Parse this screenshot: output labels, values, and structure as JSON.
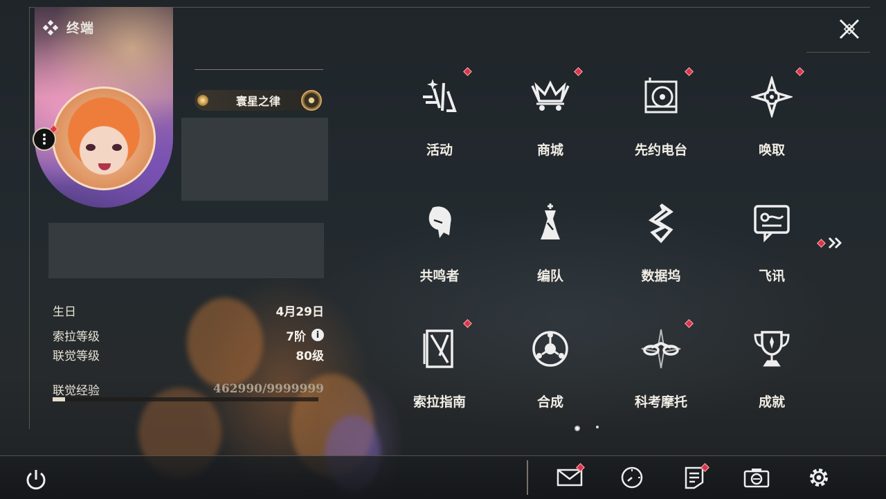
{
  "header": {
    "title": "终端"
  },
  "profile": {
    "nameplate": "寰星之律",
    "stats": [
      {
        "label": "生日",
        "value": "4月29日"
      },
      {
        "label": "索拉等级",
        "value": "7阶"
      },
      {
        "label": "联觉等级",
        "value": "80级"
      }
    ],
    "experience": {
      "label": "联觉经验",
      "value": "462990/9999999",
      "progress_fraction": 0.046
    }
  },
  "grid": {
    "items": [
      {
        "label": "活动",
        "icon": "activity-icon",
        "badge": true
      },
      {
        "label": "商城",
        "icon": "shop-crown-icon",
        "badge": true
      },
      {
        "label": "先约电台",
        "icon": "radio-icon",
        "badge": true
      },
      {
        "label": "唤取",
        "icon": "convene-compass-icon",
        "badge": true
      },
      {
        "label": "共鸣者",
        "icon": "resonator-head-icon",
        "badge": false
      },
      {
        "label": "编队",
        "icon": "team-chess-icon",
        "badge": false
      },
      {
        "label": "数据坞",
        "icon": "data-bank-icon",
        "badge": false
      },
      {
        "label": "飞讯",
        "icon": "message-bubble-icon",
        "badge": false
      },
      {
        "label": "索拉指南",
        "icon": "guide-book-icon",
        "badge": true
      },
      {
        "label": "合成",
        "icon": "synthesis-icon",
        "badge": false
      },
      {
        "label": "科考摩托",
        "icon": "motorbike-icon",
        "badge": true
      },
      {
        "label": "成就",
        "icon": "trophy-icon",
        "badge": false
      }
    ],
    "page_count": 2,
    "current_page": 1
  },
  "bottom_bar": {
    "icons": [
      {
        "name": "mail-icon",
        "badge": true
      },
      {
        "name": "clock-icon",
        "badge": false
      },
      {
        "name": "notice-icon",
        "badge": true
      },
      {
        "name": "camera-icon",
        "badge": false
      },
      {
        "name": "settings-gear-icon",
        "badge": false
      }
    ]
  },
  "colors": {
    "badge_red": "#d9364b",
    "accent_gold": "#cfa762",
    "text_light": "#f2eee6"
  }
}
